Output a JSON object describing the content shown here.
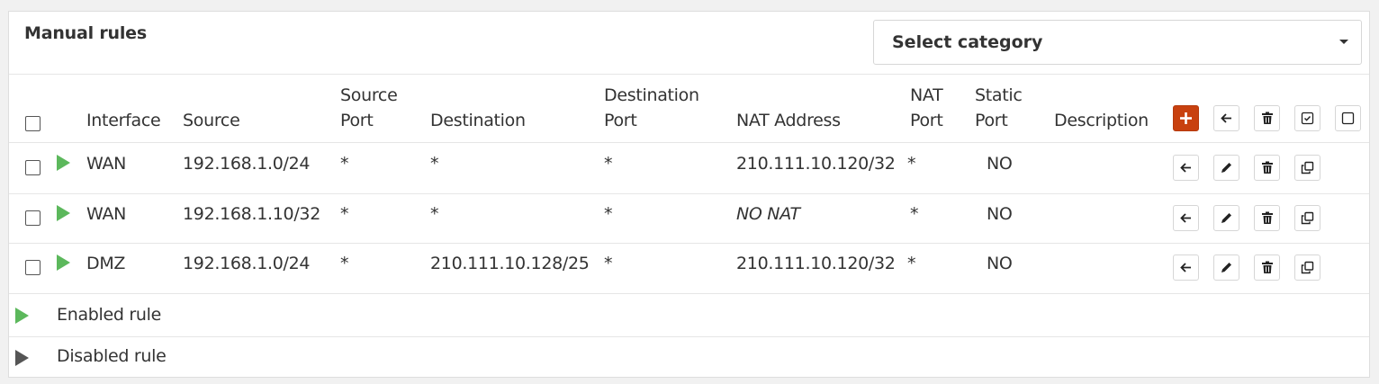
{
  "panel": {
    "title": "Manual rules",
    "category_select": {
      "value": "Select category"
    }
  },
  "table": {
    "headers": {
      "interface": "Interface",
      "source": "Source",
      "source_port_1": "Source",
      "source_port_2": "Port",
      "destination": "Destination",
      "destination_port_1": "Destination",
      "destination_port_2": "Port",
      "nat_address": "NAT Address",
      "nat_port_1": "NAT",
      "nat_port_2": "Port",
      "static_port_1": "Static",
      "static_port_2": "Port",
      "description": "Description"
    },
    "rows": [
      {
        "interface": "WAN",
        "source": "192.168.1.0/24",
        "source_port": "*",
        "destination": "*",
        "destination_port": "*",
        "nat_address": "210.111.10.120/32",
        "nat_port": "*",
        "static_port": "NO",
        "description": ""
      },
      {
        "interface": "WAN",
        "source": "192.168.1.10/32",
        "source_port": "*",
        "destination": "*",
        "destination_port": "*",
        "nat_address": "NO NAT",
        "nat_port": "*",
        "static_port": "NO",
        "description": ""
      },
      {
        "interface": "DMZ",
        "source": "192.168.1.0/24",
        "source_port": "*",
        "destination": "210.111.10.128/25",
        "destination_port": "*",
        "nat_address": "210.111.10.120/32",
        "nat_port": "*",
        "static_port": "NO",
        "description": ""
      }
    ]
  },
  "legend": {
    "enabled": "Enabled rule",
    "disabled": "Disabled rule"
  },
  "colors": {
    "accent_red": "#c8410f",
    "enabled_green": "#5cb85c",
    "disabled_gray": "#555555"
  },
  "icons": {
    "header_actions": [
      "plus-icon",
      "arrow-left-icon",
      "trash-icon",
      "check-square-icon",
      "square-icon"
    ],
    "row_actions": [
      "arrow-left-icon",
      "pencil-icon",
      "trash-icon",
      "clone-icon"
    ]
  }
}
